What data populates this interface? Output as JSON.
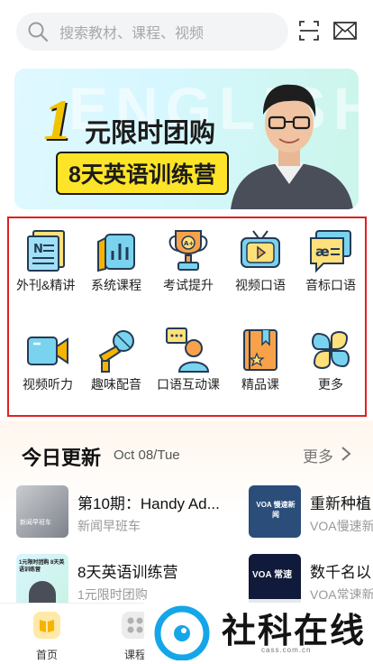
{
  "search": {
    "placeholder": "搜索教材、课程、视频"
  },
  "header_icons": [
    "search-icon",
    "scan-icon",
    "mail-icon"
  ],
  "banner": {
    "number": "1",
    "line1": "元限时团购",
    "line2": "8天英语训练营",
    "bg_word": "ENGLISH"
  },
  "categories": [
    {
      "label": "外刊&精讲",
      "icon": "newspaper-icon"
    },
    {
      "label": "系统课程",
      "icon": "bar-chart-book-icon"
    },
    {
      "label": "考试提升",
      "icon": "trophy-icon"
    },
    {
      "label": "视频口语",
      "icon": "tv-play-icon"
    },
    {
      "label": "音标口语",
      "icon": "phonetic-bubble-icon"
    },
    {
      "label": "视频听力",
      "icon": "video-camera-icon"
    },
    {
      "label": "趣味配音",
      "icon": "microphone-icon"
    },
    {
      "label": "口语互动课",
      "icon": "chat-person-icon"
    },
    {
      "label": "精品课",
      "icon": "book-star-icon"
    },
    {
      "label": "更多",
      "icon": "four-leaf-icon"
    }
  ],
  "today": {
    "title": "今日更新",
    "date": "Oct 08/Tue",
    "more": "更多"
  },
  "updates": [
    {
      "title": "第10期：Handy Ad...",
      "sub": "新闻早班车",
      "thumb_text": "新闻早班车"
    },
    {
      "title": "重新种植",
      "sub": "VOA慢速新",
      "thumb_text": "VOA 慢速新闻"
    },
    {
      "title": "8天英语训练营",
      "sub": "1元限时团购",
      "thumb_text": "1元限时团购 8天英语训练营"
    },
    {
      "title": "数千名以",
      "sub": "VOA常速新",
      "thumb_text": "VOA 常速"
    }
  ],
  "tabs": [
    {
      "label": "首页",
      "icon": "home-book-icon"
    },
    {
      "label": "课程",
      "icon": "grid-dots-icon"
    }
  ],
  "watermark": {
    "text": "社科在线",
    "url": "cass.com.cn"
  },
  "colors": {
    "highlight_border": "#e02020",
    "banner_yellow": "#fde428",
    "tab_active": "#f5b400"
  }
}
